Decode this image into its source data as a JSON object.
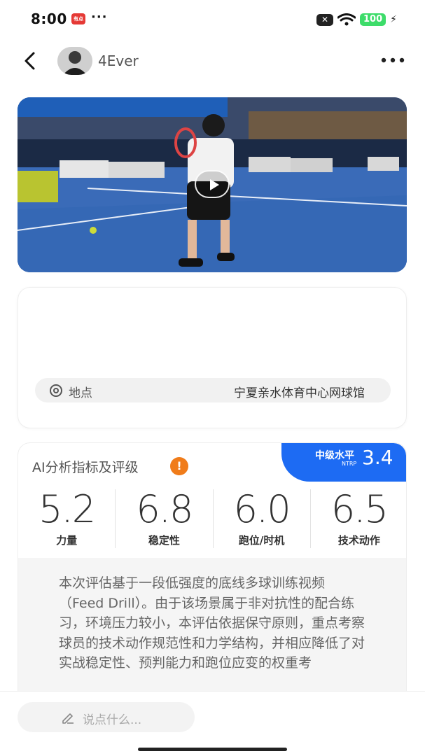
{
  "status_bar": {
    "time": "8:00",
    "app_badge": "有点",
    "dots": "···",
    "close_label": "✕",
    "battery": "100"
  },
  "header": {
    "username": "4Ever"
  },
  "location": {
    "label": "地点",
    "value": "宁夏亲水体育中心网球馆"
  },
  "ai_analysis": {
    "title": "AI分析指标及评级",
    "warning": "!",
    "level_label": "中级水平",
    "ntrp_label": "NTRP",
    "level_score": "3.4",
    "metrics": [
      {
        "value": "5.2",
        "label": "力量"
      },
      {
        "value": "6.8",
        "label": "稳定性"
      },
      {
        "value": "6.0",
        "label": "跑位/时机"
      },
      {
        "value": "6.5",
        "label": "技术动作"
      }
    ],
    "summary": "本次评估基于一段低强度的底线多球训练视频（Feed Drill）。由于该场景属于非对抗性的配合练习，环境压力较小，本评估依据保守原则，重点考察球员的技术动作规范性和力学结构，并相应降低了对实战稳定性、预判能力和跑位应变的权重考"
  },
  "comment": {
    "placeholder": "说点什么..."
  }
}
